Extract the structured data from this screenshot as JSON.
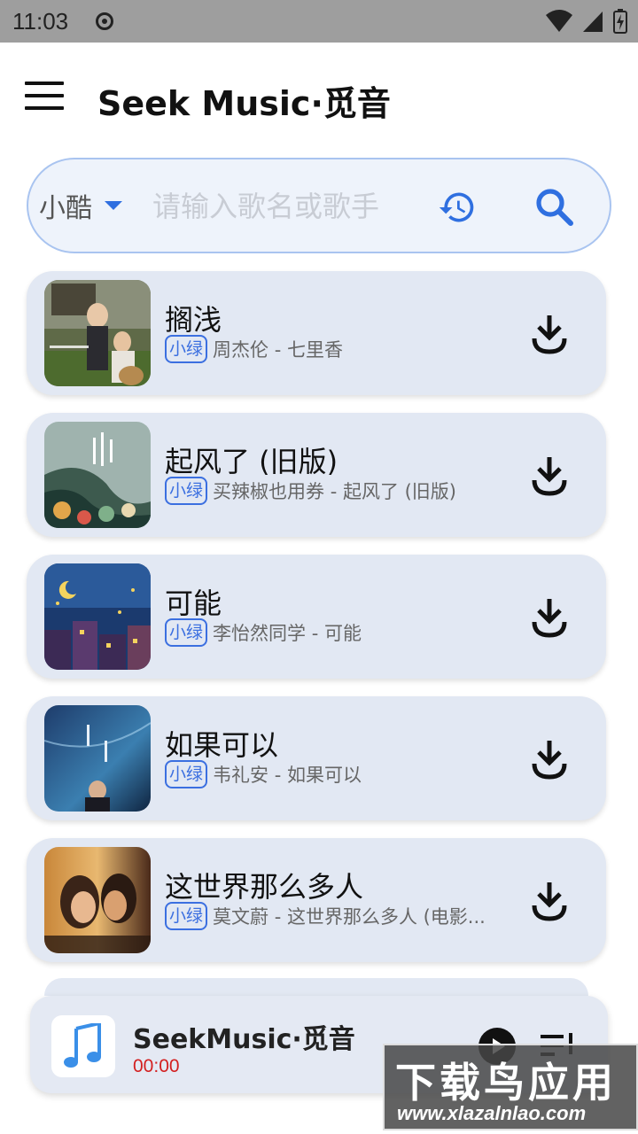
{
  "status_bar": {
    "time": "11:03"
  },
  "app_bar": {
    "title": "Seek Music·觅音",
    "menu_icon": "menu-icon"
  },
  "search": {
    "source": "小酷",
    "placeholder": "请输入歌名或歌手",
    "value": "",
    "history_icon": "history-icon",
    "search_icon": "search-icon"
  },
  "songs": [
    {
      "title": "搁浅",
      "badge": "小绿",
      "artist": "周杰伦 - 七里香"
    },
    {
      "title": "起风了 (旧版)",
      "badge": "小绿",
      "artist": "买辣椒也用券 - 起风了 (旧版)"
    },
    {
      "title": "可能",
      "badge": "小绿",
      "artist": "李怡然同学 - 可能"
    },
    {
      "title": "如果可以",
      "badge": "小绿",
      "artist": "韦礼安 - 如果可以"
    },
    {
      "title": "这世界那么多人",
      "badge": "小绿",
      "artist": "莫文蔚 - 这世界那么多人 (电影..."
    }
  ],
  "player": {
    "title": "SeekMusic·觅音",
    "time": "00:00"
  },
  "watermark": {
    "main": "下载鸟应用",
    "url": "www.xlazalnlao.com"
  },
  "colors": {
    "accent": "#2f6fe0",
    "card_bg": "#e2e8f3",
    "time_red": "#d32020"
  }
}
